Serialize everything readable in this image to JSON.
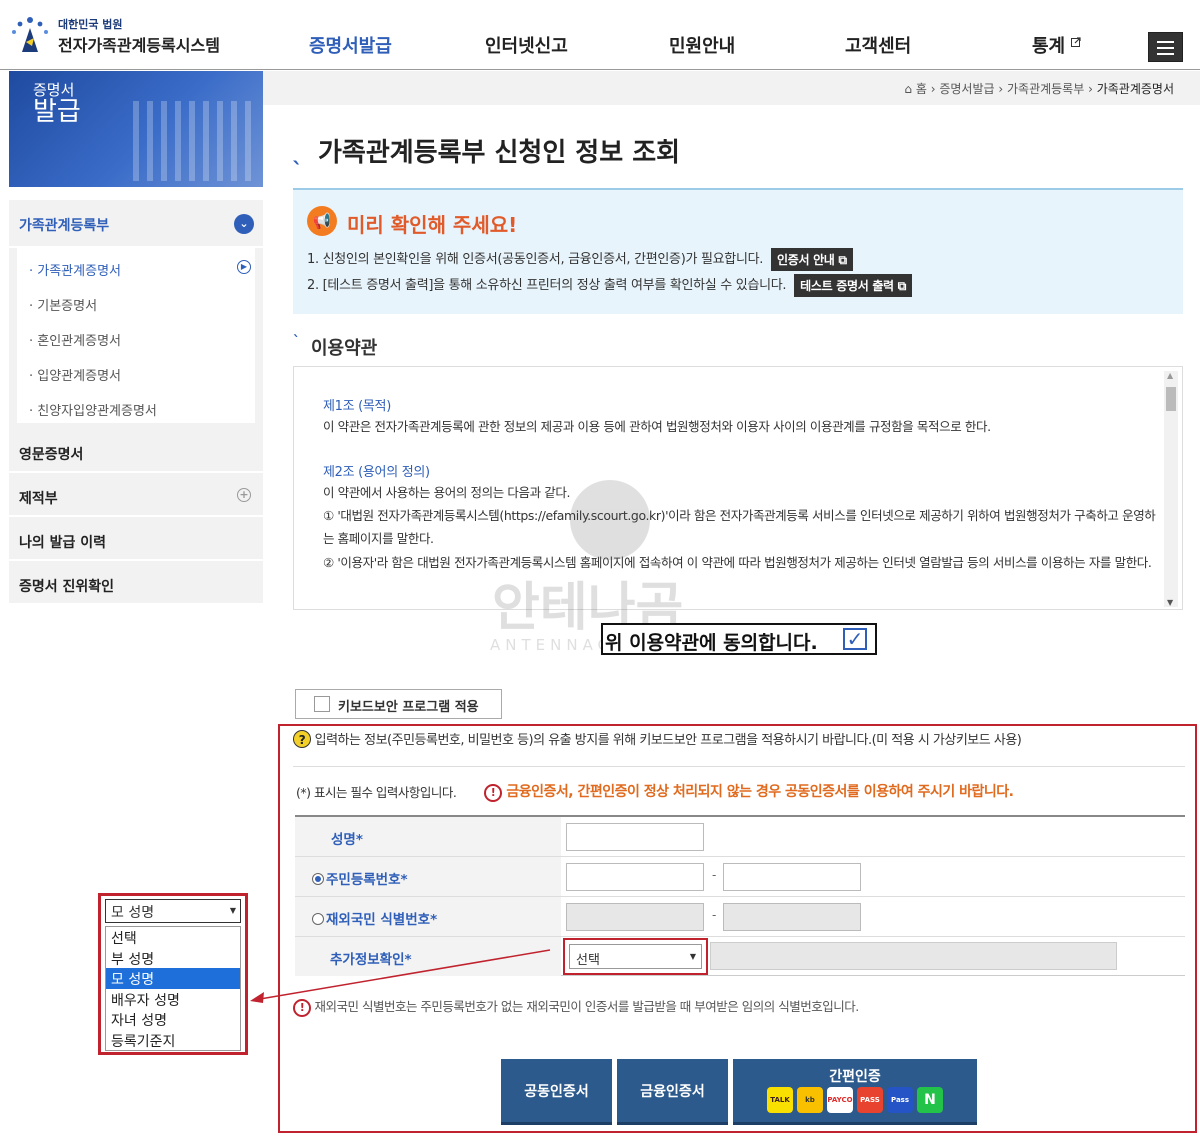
{
  "header": {
    "org": "대한민국 법원",
    "system": "전자가족관계등록시스템",
    "nav": [
      "증명서발급",
      "인터넷신고",
      "민원안내",
      "고객센터",
      "통계"
    ]
  },
  "banner": {
    "line1": "증명서",
    "line2": "발급"
  },
  "sidebar": {
    "main1": "가족관계등록부",
    "subs": [
      "· 가족관계증명서",
      "· 기본증명서",
      "· 혼인관계증명서",
      "· 입양관계증명서",
      "· 친양자입양관계증명서"
    ],
    "main2": "영문증명서",
    "main3": "제적부",
    "main4": "나의 발급 이력",
    "main5": "증명서 진위확인"
  },
  "breadcrumb": {
    "home": "홈",
    "c1": "증명서발급",
    "c2": "가족관계등록부",
    "current": "가족관계증명서"
  },
  "page_title": "가족관계등록부 신청인 정보 조회",
  "notice": {
    "title": "미리 확인해 주세요!",
    "line1": "1. 신청인의 본인확인을 위해 인증서(공동인증서, 금융인증서, 간편인증)가 필요합니다.",
    "line1_btn": "인증서 안내",
    "line2": "2. [테스트 증명서 출력]을 통해 소유하신 프린터의 정상 출력 여부를 확인하실 수 있습니다.",
    "line2_btn": "테스트 증명서 출력"
  },
  "terms": {
    "title": "이용약관",
    "art1_head": "제1조 (목적)",
    "art1_body": "이 약관은 전자가족관계등록에 관한 정보의 제공과 이용 등에 관하여 법원행정처와 이용자 사이의 이용관계를 규정함을 목적으로 한다.",
    "art2_head": "제2조 (용어의 정의)",
    "art2_body1": "이 약관에서 사용하는 용어의 정의는 다음과 같다.",
    "art2_body2": "① '대법원 전자가족관계등록시스템(https://efamily.scourt.go.kr)'이라 함은 전자가족관계등록 서비스를 인터넷으로 제공하기 위하여 법원행정처가 구축하고 운영하는 홈페이지를 말한다.",
    "art2_body3": "② '이용자'라 함은 대법원 전자가족관계등록시스템 홈페이지에 접속하여 이 약관에 따라 법원행정처가 제공하는 인터넷 열람발급 등의 서비스를 이용하는 자를 말한다.",
    "agree": "위 이용약관에 동의합니다."
  },
  "watermark": {
    "ko": "안테나곰",
    "en": "ANTENNAGOM"
  },
  "keyboard": {
    "label": "키보드보안 프로그램 적용",
    "notice": "입력하는 정보(주민등록번호, 비밀번호 등)의 유출 방지를 위해 키보드보안 프로그램을 적용하시기 바랍니다.(미 적용 시 가상키보드 사용)"
  },
  "form": {
    "required_note": "(*) 표시는 필수 입력사항입니다.",
    "warning": "금융인증서, 간편인증이 정상 처리되지 않는 경우 공동인증서를 이용하여 주시기 바랍니다.",
    "name_label": "성명",
    "rrn_label": "주민등록번호",
    "foreign_label": "재외국민 식별번호",
    "extra_label": "추가정보확인",
    "star": "*",
    "dash": "-",
    "select_value": "선택",
    "foreign_note": "재외국민 식별번호는 주민등록번호가 없는 재외국민이 인증서를 발급받을 때 부여받은 임의의 식별번호입니다."
  },
  "buttons": {
    "joint": "공동인증서",
    "financial": "금융인증서",
    "simple": "간편인증"
  },
  "simple_icons": [
    "TALK",
    "kb",
    "PAYCO",
    "PASS",
    "Pass",
    "N"
  ],
  "dropdown": {
    "selected": "모 성명",
    "options": [
      "선택",
      "부 성명",
      "모 성명",
      "배우자 성명",
      "자녀 성명",
      "등록기준지"
    ],
    "highlighted_index": 2
  }
}
